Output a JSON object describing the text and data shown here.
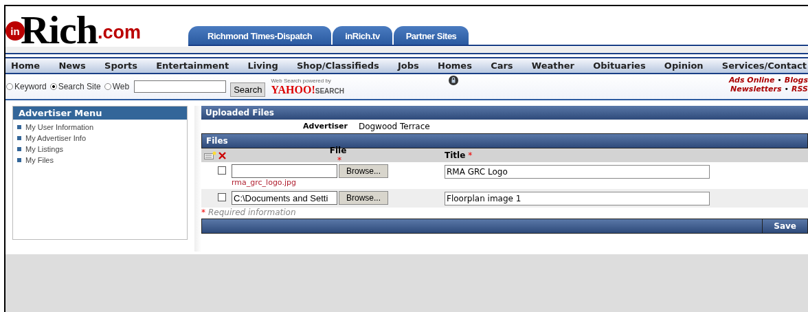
{
  "logo": {
    "badge": "in",
    "name": "Rich",
    "suffix": ".com"
  },
  "site_tabs": [
    "Richmond Times-Dispatch",
    "inRich.tv",
    "Partner Sites"
  ],
  "nav": [
    "Home",
    "News",
    "Sports",
    "Entertainment",
    "Living",
    "Shop/Classifieds",
    "Jobs",
    "Homes",
    "Cars",
    "Weather",
    "Obituaries",
    "Opinion",
    "Services/Contact"
  ],
  "search": {
    "options": [
      {
        "label": "Keyword",
        "selected": false
      },
      {
        "label": "Search Site",
        "selected": true
      },
      {
        "label": "Web",
        "selected": false
      }
    ],
    "button": "Search",
    "powered_by": "Web Search powered by",
    "yahoo": "YAHOO!",
    "yahoo_search": "SEARCH"
  },
  "links": [
    [
      "Ads Online",
      "Blogs"
    ],
    [
      "Newsletters",
      "RSS"
    ]
  ],
  "link_separator": "•",
  "sidebar": {
    "title": "Advertiser Menu",
    "items": [
      "My User Information",
      "My Advertiser Info",
      "My Listings",
      "My Files"
    ]
  },
  "panel": {
    "title": "Uploaded Files",
    "advertiser_label": "Advertiser",
    "advertiser": "Dogwood Terrace",
    "section": "Files",
    "columns": [
      "File",
      "Title"
    ],
    "required_mark": "*",
    "rows": [
      {
        "checked": false,
        "file": "",
        "browse": "Browse...",
        "current": "rma_grc_logo.jpg",
        "title": "RMA GRC Logo"
      },
      {
        "checked": false,
        "file": "C:\\Documents and Setti",
        "browse": "Browse...",
        "title": "Floorplan image 1"
      }
    ],
    "note": "Required information",
    "save": "Save"
  }
}
